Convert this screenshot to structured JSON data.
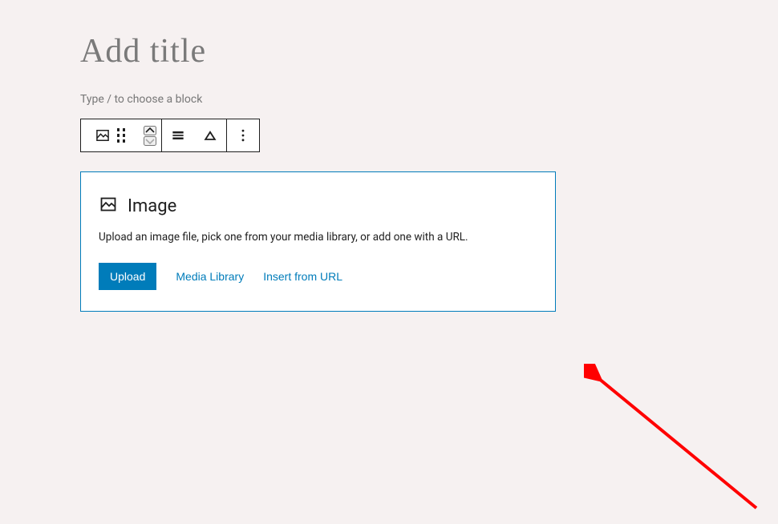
{
  "colors": {
    "accent": "#007cba",
    "bg": "#f6f1f1",
    "border": "#1e1e1e"
  },
  "editor": {
    "title_placeholder": "Add title",
    "block_hint": "Type / to choose a block"
  },
  "image_block": {
    "heading": "Image",
    "description": "Upload an image file, pick one from your media library, or add one with a URL.",
    "upload_label": "Upload",
    "media_library_label": "Media Library",
    "insert_url_label": "Insert from URL"
  },
  "icons": {
    "image": "image-icon",
    "drag": "drag-handle-icon",
    "move_up": "chevron-up-icon",
    "move_down": "chevron-down-icon",
    "align": "align-icon",
    "replace": "replace-icon",
    "more": "more-vertical-icon"
  }
}
